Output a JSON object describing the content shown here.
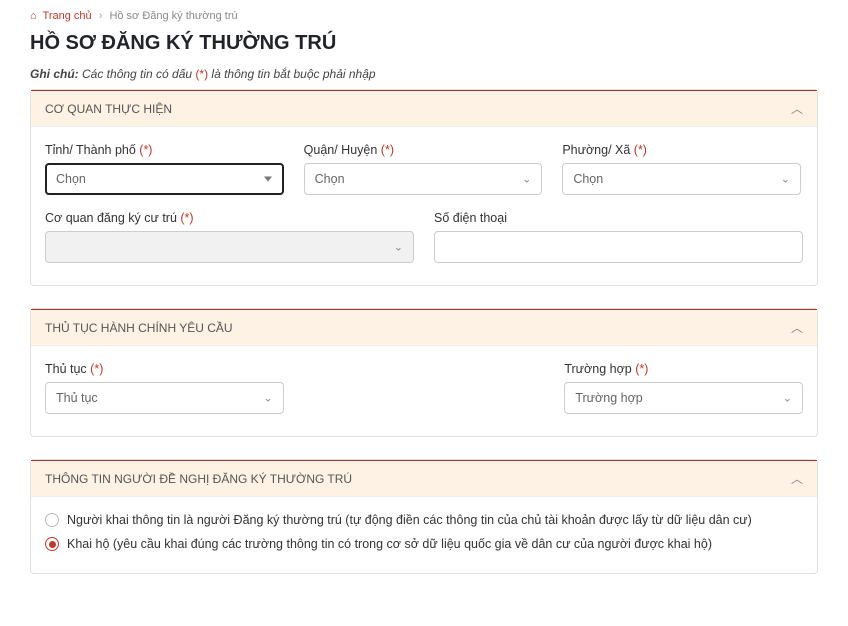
{
  "breadcrumb": {
    "home": "Trang chủ",
    "current": "Hồ sơ Đăng ký thường trú"
  },
  "pageTitle": "HỒ SƠ ĐĂNG KÝ THƯỜNG TRÚ",
  "note": {
    "label": "Ghi chú:",
    "before": " Các thông tin có dấu ",
    "mark": "(*)",
    "after": " là thông tin bắt buộc phải nhập"
  },
  "panels": {
    "org": {
      "title": "CƠ QUAN THỰC HIỆN",
      "fields": {
        "province": {
          "label": "Tỉnh/ Thành phố ",
          "req": "(*)",
          "value": "Chọn"
        },
        "district": {
          "label": "Quận/ Huyện ",
          "req": "(*)",
          "value": "Chọn"
        },
        "ward": {
          "label": "Phường/ Xã ",
          "req": "(*)",
          "value": "Chọn"
        },
        "agency": {
          "label": "Cơ quan đăng ký cư trú ",
          "req": "(*)",
          "value": ""
        },
        "phone": {
          "label": "Số điện thoại",
          "value": ""
        }
      }
    },
    "proc": {
      "title": "THỦ TỤC HÀNH CHÍNH YÊU CẦU",
      "fields": {
        "procedure": {
          "label": "Thủ tục ",
          "req": "(*)",
          "value": "Thủ tục"
        },
        "case": {
          "label": "Trường hợp ",
          "req": "(*)",
          "value": "Trường hợp"
        }
      }
    },
    "info": {
      "title": "THÔNG TIN NGƯỜI ĐỀ NGHỊ ĐĂNG KÝ THƯỜNG TRÚ",
      "radios": {
        "opt1": "Người khai thông tin là người Đăng ký thường trú (tự động điền các thông tin của chủ tài khoản được lấy từ dữ liệu dân cư)",
        "opt2": "Khai hộ (yêu cầu khai đúng các trường thông tin có trong cơ sở dữ liệu quốc gia về dân cư của người được khai hộ)"
      }
    }
  }
}
